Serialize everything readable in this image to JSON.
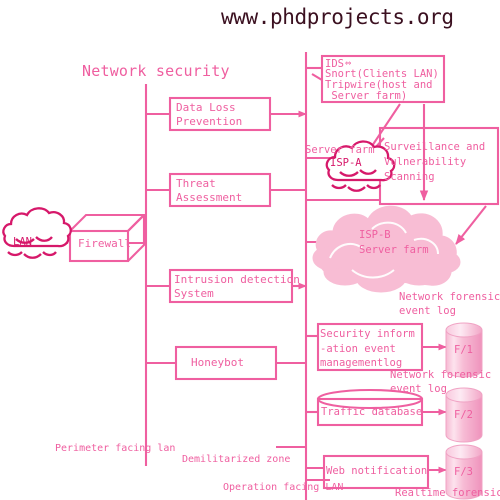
{
  "page": {
    "site_url": "www.phdprojects.org",
    "title": "Network security",
    "accent": "#ef5fa0",
    "accent_dark": "#d6186a",
    "cloud_fill": "#f8bdd4",
    "url_color": "#3b1020",
    "background": "#ffffff"
  },
  "nodes": {
    "lan_cloud": {
      "label": "LAN",
      "icon": "cloud-icon"
    },
    "firewall": {
      "label": "Firewall",
      "icon": "firewall-box-icon"
    },
    "data_loss_prevention": {
      "line1": "Data Loss",
      "line2": "Prevention"
    },
    "threat_assessment": {
      "line1": "Threat",
      "line2": "Assessment"
    },
    "intrusion_detection": {
      "line1": "Intrusion detection",
      "line2": "System"
    },
    "honeybot": {
      "label": "Honeybot"
    },
    "ids_box": {
      "line1": "IDS",
      "line2": "Snort(Clients LAN)",
      "line3": "Tripwire(host and",
      "line4": " Server farm)",
      "arrow_glyph": "⇔"
    },
    "surveillance_box": {
      "line1": "Surveillance and",
      "line2": "Vulnerability",
      "line3": "Scanning"
    },
    "isp_a_cloud": {
      "caption": "Server farm",
      "label": "ISP-A",
      "icon": "cloud-icon"
    },
    "isp_b_cloud": {
      "line1": "ISP-B",
      "line2": "Server farm",
      "icon": "cloud-icon"
    },
    "siem_box": {
      "line1": "Security inform",
      "line2": "-ation event",
      "line3": "managementlog"
    },
    "traffic_database": {
      "label": "Traffic database",
      "icon": "database-icon"
    },
    "web_notification": {
      "label": "Web notification"
    },
    "forensic_1": {
      "label": "F/1",
      "icon": "database-cylinder-icon"
    },
    "forensic_2": {
      "label": "F/2",
      "icon": "database-cylinder-icon"
    },
    "forensic_3": {
      "label": "F/3",
      "icon": "database-cylinder-icon"
    }
  },
  "annotations": {
    "forensic_log_1": {
      "line1": "Network forensic",
      "line2": "event log"
    },
    "forensic_log_2": {
      "line1": "Network forensic",
      "line2": "event log"
    },
    "realtime_forensic": {
      "label": "Realtime forensic"
    }
  },
  "zones": {
    "perimeter": "Perimeter facing lan",
    "dmz": "Demilitarized zone",
    "operation": "Operation facing LAN"
  }
}
